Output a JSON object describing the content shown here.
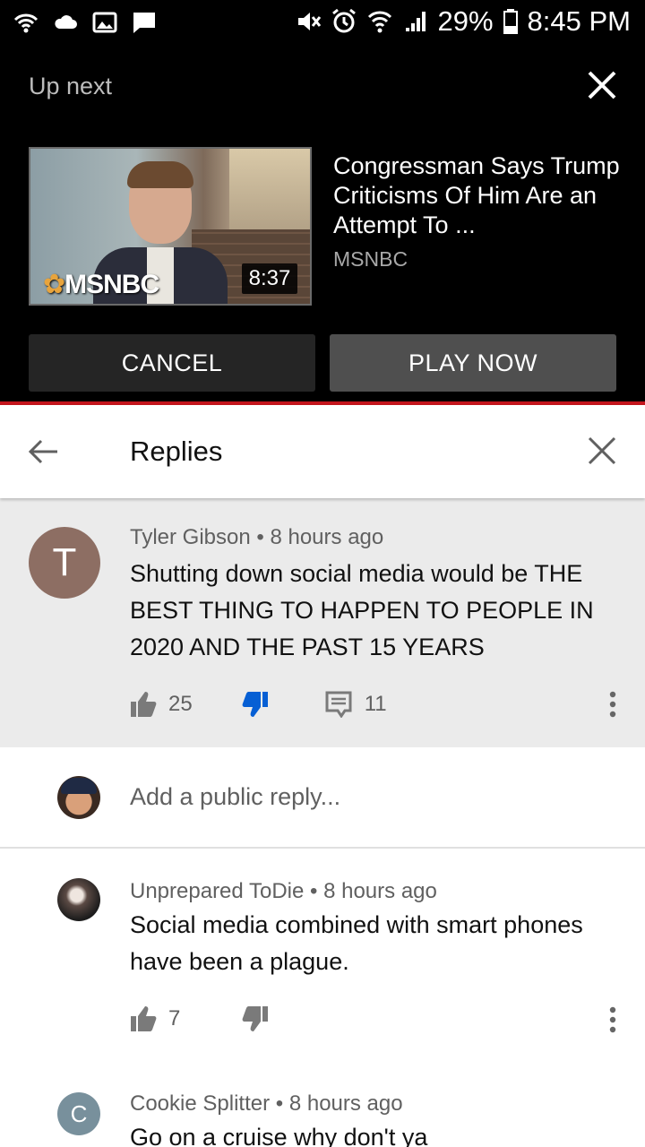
{
  "status_bar": {
    "battery": "29%",
    "time": "8:45 PM",
    "left_icons": [
      "wifi-calling-icon",
      "cloud-icon",
      "image-icon",
      "message-icon"
    ],
    "right_icons": [
      "mute-icon",
      "alarm-icon",
      "wifi-icon",
      "signal-icon",
      "battery-icon"
    ]
  },
  "up_next": {
    "heading": "Up next",
    "video": {
      "title": "Congressman Says Trump Criticisms Of Him Are an Attempt To ...",
      "channel": "MSNBC",
      "duration": "8:37",
      "thumbnail_logo": "MSNBC"
    },
    "cancel_label": "CANCEL",
    "play_label": "PLAY NOW"
  },
  "replies_header": {
    "title": "Replies"
  },
  "top_comment": {
    "avatar_letter": "T",
    "author": "Tyler Gibson",
    "time": "8 hours ago",
    "text": "Shutting down social media would be THE BEST THING TO HAPPEN TO PEOPLE IN 2020 AND THE PAST 15 YEARS",
    "likes": "25",
    "replies": "11",
    "disliked": true
  },
  "reply_input": {
    "placeholder": "Add a public reply..."
  },
  "replies": [
    {
      "author": "Unprepared ToDie",
      "time": "8 hours ago",
      "text": "Social media combined with smart phones have been a plague.",
      "likes": "7"
    },
    {
      "avatar_letter": "C",
      "author": "Cookie Splitter",
      "time": "8 hours ago",
      "text": "Go on a cruise why don't ya"
    }
  ],
  "colors": {
    "accent_red": "#c4151c",
    "dislike_active": "#065fd4",
    "meta_gray": "#606060"
  }
}
